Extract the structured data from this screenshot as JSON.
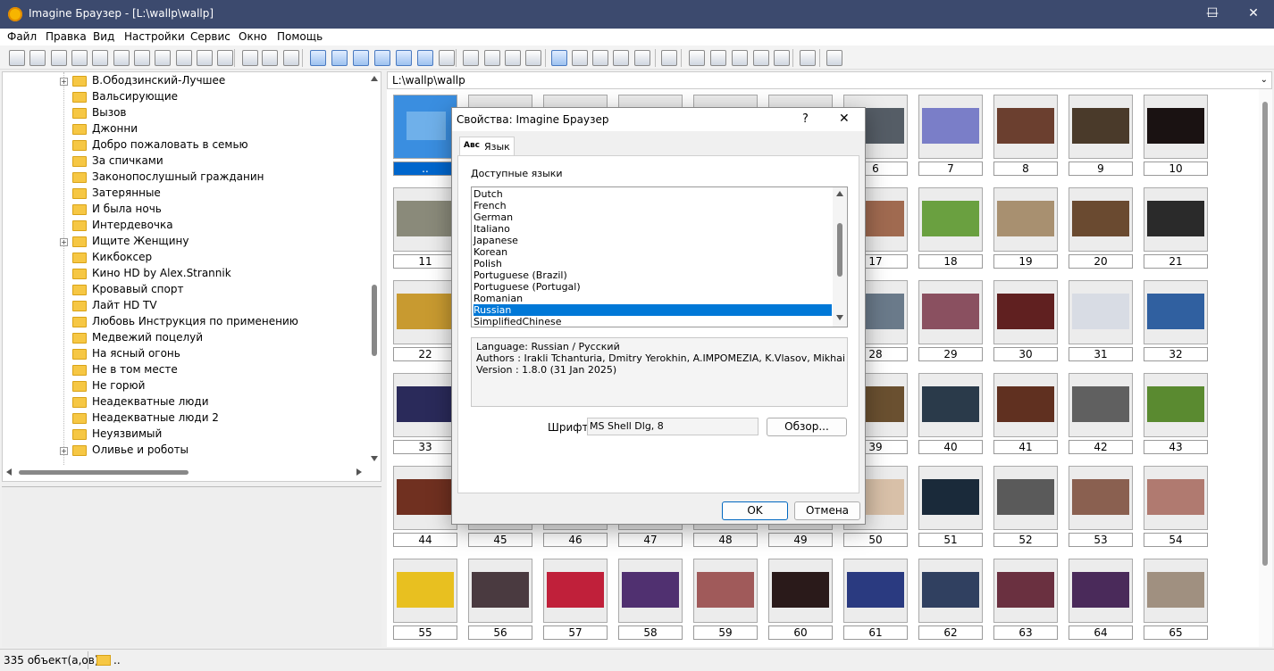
{
  "window": {
    "title": "Imagine Браузер - [L:\\wallp\\wallp]",
    "minimize": "—",
    "maximize": "☐",
    "close": "✕"
  },
  "menu": [
    "Файл",
    "Правка",
    "Вид",
    "Настройки",
    "Сервис",
    "Окно",
    "Помощь"
  ],
  "tree": {
    "items": [
      {
        "label": "В.Ободзинский-Лучшее",
        "expandable": true
      },
      {
        "label": "Вальсирующие",
        "expandable": false
      },
      {
        "label": "Вызов",
        "expandable": false
      },
      {
        "label": "Джонни",
        "expandable": false
      },
      {
        "label": "Добро пожаловать в семью",
        "expandable": false
      },
      {
        "label": "За спичками",
        "expandable": false
      },
      {
        "label": "Законопослушный гражданин",
        "expandable": false
      },
      {
        "label": "Затерянные",
        "expandable": false
      },
      {
        "label": "И была ночь",
        "expandable": false
      },
      {
        "label": "Интердевочка",
        "expandable": false
      },
      {
        "label": "Ищите Женщину",
        "expandable": true
      },
      {
        "label": "Кикбоксер",
        "expandable": false
      },
      {
        "label": "Кино HD by Alex.Strannik",
        "expandable": false
      },
      {
        "label": "Кровавый спорт",
        "expandable": false
      },
      {
        "label": "Лайт HD TV",
        "expandable": false
      },
      {
        "label": "Любовь Инструкция по применению",
        "expandable": false
      },
      {
        "label": "Медвежий поцелуй",
        "expandable": false
      },
      {
        "label": "На ясный огонь",
        "expandable": false
      },
      {
        "label": "Не в том месте",
        "expandable": false
      },
      {
        "label": "Не горюй",
        "expandable": false
      },
      {
        "label": "Неадекватные люди",
        "expandable": false
      },
      {
        "label": "Неадекватные люди 2",
        "expandable": false
      },
      {
        "label": "Неуязвимый",
        "expandable": false
      },
      {
        "label": "Оливье и роботы",
        "expandable": true
      }
    ]
  },
  "path": "L:\\wallp\\wallp",
  "gallery": {
    "captions": [
      "..",
      "",
      "",
      "",
      "",
      "",
      "6",
      "7",
      "8",
      "9",
      "10",
      "11",
      "",
      "",
      "",
      "",
      "",
      "17",
      "18",
      "19",
      "20",
      "21",
      "22",
      "",
      "",
      "",
      "",
      "",
      "28",
      "29",
      "30",
      "31",
      "32",
      "33",
      "",
      "",
      "",
      "",
      "",
      "39",
      "40",
      "41",
      "42",
      "43",
      "44",
      "45",
      "46",
      "47",
      "48",
      "49",
      "50",
      "51",
      "52",
      "53",
      "54",
      "55",
      "56",
      "57",
      "58",
      "59",
      "60",
      "61",
      "62",
      "63",
      "64",
      "65"
    ],
    "colors": [
      "#5a9bd4",
      "#ccc",
      "#ccc",
      "#ccc",
      "#ccc",
      "#ccc",
      "#555d66",
      "#7a7ec8",
      "#6b3f2f",
      "#4a3a2a",
      "#1a1212",
      "#8a8a7a",
      "#ccc",
      "#ccc",
      "#ccc",
      "#ccc",
      "#ccc",
      "#a06a50",
      "#6aa040",
      "#a89070",
      "#6a4a30",
      "#2a2a2a",
      "#c89a30",
      "#ccc",
      "#ccc",
      "#ccc",
      "#ccc",
      "#ccc",
      "#6a7a8a",
      "#8a5060",
      "#602020",
      "#d8dce4",
      "#3060a0",
      "#2a2a5a",
      "#ccc",
      "#ccc",
      "#ccc",
      "#ccc",
      "#ccc",
      "#6a5030",
      "#2a3a4a",
      "#603020",
      "#606060",
      "#5a8a30",
      "#703020",
      "#ccc",
      "#ccc",
      "#ccc",
      "#ccc",
      "#ccc",
      "#d8c0a8",
      "#1a2a3a",
      "#5a5a5a",
      "#8a6050",
      "#b07a70",
      "#e8c020",
      "#4a3a40",
      "#c0203a",
      "#503070",
      "#a05a5a",
      "#2a1a1a",
      "#2a3a80",
      "#304060",
      "#6a3040",
      "#4a2a5a",
      "#a09080"
    ]
  },
  "dialog": {
    "title": "Свойства: Imagine Браузер",
    "help": "?",
    "close": "✕",
    "tab_icon": "Aвс",
    "tab": "Язык",
    "available_label": "Доступные языки",
    "languages": [
      "Dutch",
      "French",
      "German",
      "Italiano",
      "Japanese",
      "Korean",
      "Polish",
      "Portuguese (Brazil)",
      "Portuguese (Portugal)",
      "Romanian",
      "Russian",
      "SimplifiedChinese"
    ],
    "selected_language": "Russian",
    "info": {
      "language": "Language: Russian / Русский",
      "authors": "Authors : Irakli Tchanturia, Dmitry Yerokhin, A.IMPOMEZIA, K.Vlasov, Mikhail Rybakov",
      "version": "Version : 1.8.0 (31 Jan 2025)"
    },
    "font_label": "Шрифт",
    "font_value": "MS Shell Dlg, 8",
    "browse": "Обзор...",
    "ok": "OK",
    "cancel": "Отмена"
  },
  "status": {
    "count": "335 объект(а,ов)",
    "folder": ".."
  }
}
